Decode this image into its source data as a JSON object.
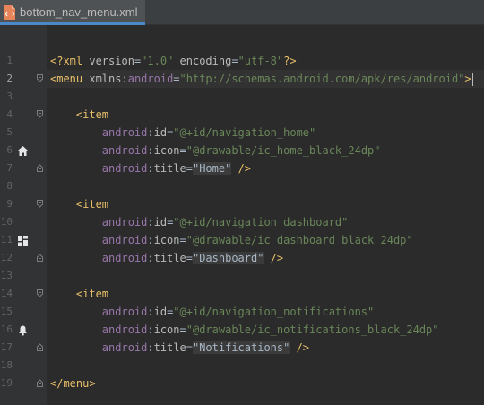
{
  "tab": {
    "filename": "bottom_nav_menu.xml",
    "icon": "xml-file-icon"
  },
  "editor": {
    "lines": [
      {
        "n": "1",
        "parts": [
          [
            "tag",
            "<?"
          ],
          [
            "tag",
            "xml "
          ],
          [
            "attr",
            "version"
          ],
          [
            "plain",
            "="
          ],
          [
            "val",
            "\"1.0\""
          ],
          [
            "plain",
            " "
          ],
          [
            "attr",
            "encoding"
          ],
          [
            "plain",
            "="
          ],
          [
            "val",
            "\"utf-8\""
          ],
          [
            "tag",
            "?>"
          ]
        ]
      },
      {
        "n": "2",
        "parts": [
          [
            "tag",
            "<menu "
          ],
          [
            "attr",
            "xmlns"
          ],
          [
            "plain",
            ":"
          ],
          [
            "ns",
            "android"
          ],
          [
            "plain",
            "="
          ],
          [
            "val",
            "\"http://schemas.android.com/apk/res/android\""
          ],
          [
            "tag",
            ">"
          ]
        ]
      },
      {
        "n": "3",
        "parts": []
      },
      {
        "n": "4",
        "parts": [
          [
            "plain",
            "    "
          ],
          [
            "tag",
            "<item"
          ]
        ]
      },
      {
        "n": "5",
        "parts": [
          [
            "plain",
            "        "
          ],
          [
            "ns",
            "android"
          ],
          [
            "plain",
            ":"
          ],
          [
            "attr",
            "id"
          ],
          [
            "plain",
            "="
          ],
          [
            "val",
            "\"@+id/navigation_home\""
          ]
        ]
      },
      {
        "n": "6",
        "parts": [
          [
            "plain",
            "        "
          ],
          [
            "ns",
            "android"
          ],
          [
            "plain",
            ":"
          ],
          [
            "attr",
            "icon"
          ],
          [
            "plain",
            "="
          ],
          [
            "val",
            "\"@drawable/ic_home_black_24dp\""
          ]
        ]
      },
      {
        "n": "7",
        "parts": [
          [
            "plain",
            "        "
          ],
          [
            "ns",
            "android"
          ],
          [
            "plain",
            ":"
          ],
          [
            "attr",
            "title"
          ],
          [
            "plain",
            "="
          ],
          [
            "str",
            "\"Home\""
          ],
          [
            "plain",
            " "
          ],
          [
            "tag",
            "/>"
          ]
        ]
      },
      {
        "n": "8",
        "parts": []
      },
      {
        "n": "9",
        "parts": [
          [
            "plain",
            "    "
          ],
          [
            "tag",
            "<item"
          ]
        ]
      },
      {
        "n": "10",
        "parts": [
          [
            "plain",
            "        "
          ],
          [
            "ns",
            "android"
          ],
          [
            "plain",
            ":"
          ],
          [
            "attr",
            "id"
          ],
          [
            "plain",
            "="
          ],
          [
            "val",
            "\"@+id/navigation_dashboard\""
          ]
        ]
      },
      {
        "n": "11",
        "parts": [
          [
            "plain",
            "        "
          ],
          [
            "ns",
            "android"
          ],
          [
            "plain",
            ":"
          ],
          [
            "attr",
            "icon"
          ],
          [
            "plain",
            "="
          ],
          [
            "val",
            "\"@drawable/ic_dashboard_black_24dp\""
          ]
        ]
      },
      {
        "n": "12",
        "parts": [
          [
            "plain",
            "        "
          ],
          [
            "ns",
            "android"
          ],
          [
            "plain",
            ":"
          ],
          [
            "attr",
            "title"
          ],
          [
            "plain",
            "="
          ],
          [
            "str",
            "\"Dashboard\""
          ],
          [
            "plain",
            " "
          ],
          [
            "tag",
            "/>"
          ]
        ]
      },
      {
        "n": "13",
        "parts": []
      },
      {
        "n": "14",
        "parts": [
          [
            "plain",
            "    "
          ],
          [
            "tag",
            "<item"
          ]
        ]
      },
      {
        "n": "15",
        "parts": [
          [
            "plain",
            "        "
          ],
          [
            "ns",
            "android"
          ],
          [
            "plain",
            ":"
          ],
          [
            "attr",
            "id"
          ],
          [
            "plain",
            "="
          ],
          [
            "val",
            "\"@+id/navigation_notifications\""
          ]
        ]
      },
      {
        "n": "16",
        "parts": [
          [
            "plain",
            "        "
          ],
          [
            "ns",
            "android"
          ],
          [
            "plain",
            ":"
          ],
          [
            "attr",
            "icon"
          ],
          [
            "plain",
            "="
          ],
          [
            "val",
            "\"@drawable/ic_notifications_black_24dp\""
          ]
        ]
      },
      {
        "n": "17",
        "parts": [
          [
            "plain",
            "        "
          ],
          [
            "ns",
            "android"
          ],
          [
            "plain",
            ":"
          ],
          [
            "attr",
            "title"
          ],
          [
            "plain",
            "="
          ],
          [
            "str",
            "\"Notifications\""
          ],
          [
            "plain",
            " "
          ],
          [
            "tag",
            "/>"
          ]
        ]
      },
      {
        "n": "18",
        "parts": []
      },
      {
        "n": "19",
        "parts": [
          [
            "tag",
            "</menu>"
          ]
        ]
      }
    ],
    "current_line": "2",
    "gutter_icons": {
      "6": "home-icon",
      "11": "dashboard-icon",
      "16": "bell-icon"
    },
    "fold_lines": {
      "2": "fold-open",
      "4": "fold-open",
      "7": "fold-close",
      "9": "fold-open",
      "12": "fold-close",
      "14": "fold-open",
      "17": "fold-close",
      "19": "fold-close"
    }
  },
  "colors": {
    "background": "#2b2b2b",
    "gutter": "#313335",
    "tag": "#e8bf6a",
    "attribute": "#bababa",
    "namespace": "#9876aa",
    "value": "#6a8759",
    "accent": "#4a88c7"
  }
}
